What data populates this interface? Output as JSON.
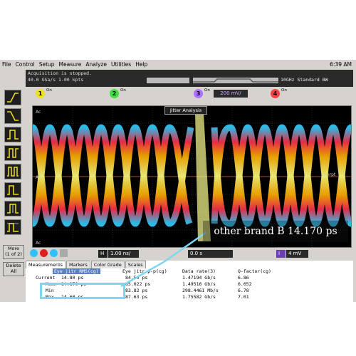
{
  "menu": {
    "items": [
      "File",
      "Control",
      "Setup",
      "Measure",
      "Analyze",
      "Utilities",
      "Help"
    ],
    "clock": "6:39 AM"
  },
  "status": {
    "line1": "Acquisition is stopped.",
    "line2": "40.0 GSa/s   1.00 kpts",
    "bandwidth": "10GHz Standard BW"
  },
  "channels": [
    {
      "num": "1",
      "on": "On",
      "color": "#f0e020"
    },
    {
      "num": "2",
      "on": "On",
      "color": "#40e040"
    },
    {
      "num": "3",
      "on": "On",
      "color": "#b070ff",
      "scale": "200 mV/"
    },
    {
      "num": "4",
      "on": "On",
      "color": "#ff4040"
    }
  ],
  "screen": {
    "box_title": "Jitter Analysis",
    "label_top": "Ac",
    "label_mid": "Ac",
    "label_bottom": "Ac",
    "label_right": "Interpt"
  },
  "timebase": {
    "h_label": "H",
    "h_value": "1.00 ns/",
    "delay": "0.0 s",
    "i_label": "I",
    "i_value": "4 mV"
  },
  "sidebar": {
    "more": "More\n(1 of 2)",
    "delete": "Delete\nAll"
  },
  "measurements": {
    "tabs": [
      "Measurements",
      "Markers",
      "Color Grade",
      "Scales"
    ],
    "headers": [
      "Eye jitr RMS(cg)",
      "Eye jitr p-p(cg)",
      "Data rate(3)",
      "Q-factor(cg)"
    ],
    "rows": [
      {
        "label": "Current",
        "c1": "14.80 ps",
        "c2": "84.50 ps",
        "c3": "1.47194 Gb/s",
        "c4": "6.86"
      },
      {
        "label": "Mean",
        "c1": "14.170 ps",
        "c2": "85.022 ps",
        "c3": "1.49516 Gb/s",
        "c4": "6.652"
      },
      {
        "label": "Min",
        "c1": "",
        "c2": "83.82 ps",
        "c3": "298.4461 Mb/s",
        "c4": "6.78"
      },
      {
        "label": "Max",
        "c1": "14.60 ps",
        "c2": "87.63 ps",
        "c3": "1.75582 Gb/s",
        "c4": "7.01"
      }
    ]
  },
  "callout": {
    "text": "other brand B  14.170 ps",
    "highlight_color": "#7fd6ef"
  }
}
